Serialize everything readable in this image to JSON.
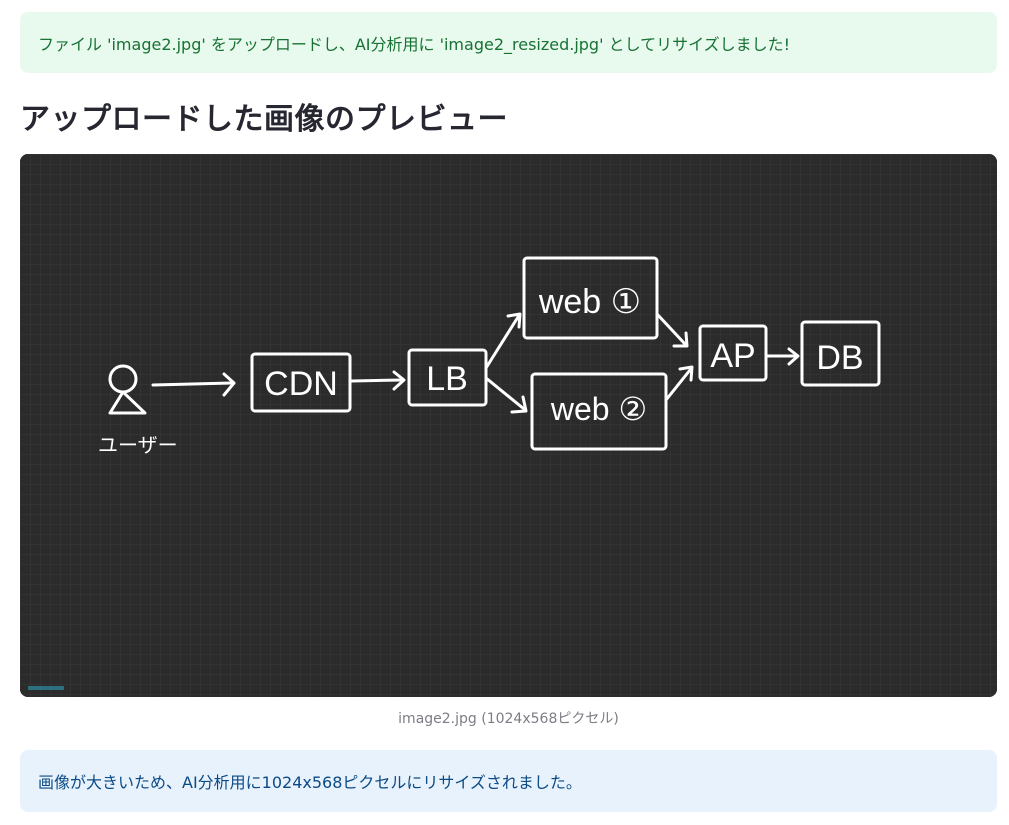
{
  "success_message": "ファイル 'image2.jpg' をアップロードし、AI分析用に 'image2_resized.jpg' としてリサイズしました!",
  "heading": "アップロードした画像のプレビュー",
  "preview": {
    "labels": {
      "user": "ユーザー",
      "cdn": "CDN",
      "lb": "LB",
      "web1": "web ①",
      "web2": "web ②",
      "ap": "AP",
      "db": "DB"
    }
  },
  "caption": "image2.jpg (1024x568ピクセル)",
  "info_message": "画像が大きいため、AI分析用に1024x568ピクセルにリサイズされました。"
}
